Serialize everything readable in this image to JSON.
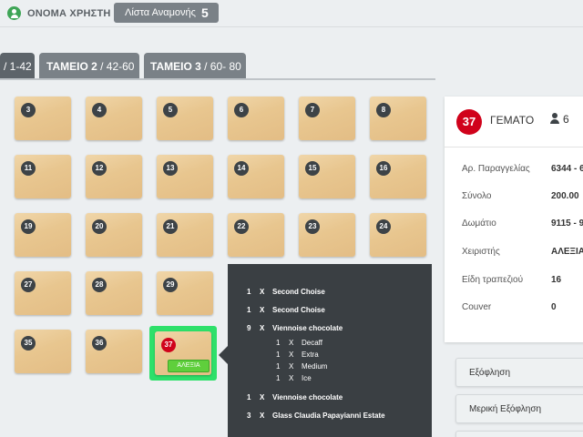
{
  "header": {
    "user_name": "ΟΝΟΜΑ ΧΡΗΣΤΗ",
    "waitlist_label": "Λίστα Αναμονής",
    "waitlist_count": "5"
  },
  "tabs": [
    {
      "name": "",
      "range": "/ 1-42"
    },
    {
      "name": "ΤΑΜΕΙΟ 2",
      "range": " / 42-60"
    },
    {
      "name": "ΤΑΜΕΙΟ 3",
      "range": " / 60- 80"
    }
  ],
  "tables": {
    "row1": [
      "3",
      "4",
      "5",
      "6",
      "7",
      "8"
    ],
    "row2": [
      "11",
      "12",
      "13",
      "14",
      "15",
      "16"
    ],
    "row3": [
      "19",
      "20",
      "21",
      "22",
      "23",
      "24"
    ],
    "row4": [
      "27",
      "28",
      "29"
    ],
    "row5": [
      "35",
      "36"
    ],
    "selected": {
      "number": "37",
      "waiter": "ΑΛΕΞΙΑ"
    }
  },
  "order_popover": {
    "lines": [
      {
        "qty": "1",
        "x": "X",
        "name": "Second Choise"
      },
      {
        "qty": "1",
        "x": "X",
        "name": "Second Choise"
      },
      {
        "qty": "9",
        "x": "X",
        "name": "Viennoise chocolate"
      },
      {
        "qty": "1",
        "x": "X",
        "name": "Decaff"
      },
      {
        "qty": "1",
        "x": "X",
        "name": "Extra"
      },
      {
        "qty": "1",
        "x": "X",
        "name": "Medium"
      },
      {
        "qty": "1",
        "x": "X",
        "name": "Ice"
      },
      {
        "qty": "1",
        "x": "X",
        "name": "Viennoise chocolate"
      },
      {
        "qty": "3",
        "x": "X",
        "name": "Glass Claudia Papayianni Estate"
      }
    ]
  },
  "table_panel": {
    "table_number": "37",
    "status": "ΓΕΜΑΤΟ",
    "guests": "6",
    "fields": [
      {
        "label": "Αρ. Παραγγελίας",
        "value": "6344 - 6"
      },
      {
        "label": "Σύνολο",
        "value": "200.00"
      },
      {
        "label": "Δωμάτιο",
        "value": "9115 - 9"
      },
      {
        "label": "Χειριστής",
        "value": "ΑΛΕΞΙΑ"
      },
      {
        "label": "Είδη τραπεζιού",
        "value": "16"
      },
      {
        "label": "Couver",
        "value": "0"
      }
    ]
  },
  "actions": {
    "pay_label": "Εξόφληση",
    "partial_pay_label": "Μερική Εξόφληση"
  },
  "colors": {
    "status_full": "#d0021b",
    "selected_frame": "#2ee06a",
    "waiter_badge": "#5fcf3c",
    "table_wood": "#e8c68f"
  }
}
